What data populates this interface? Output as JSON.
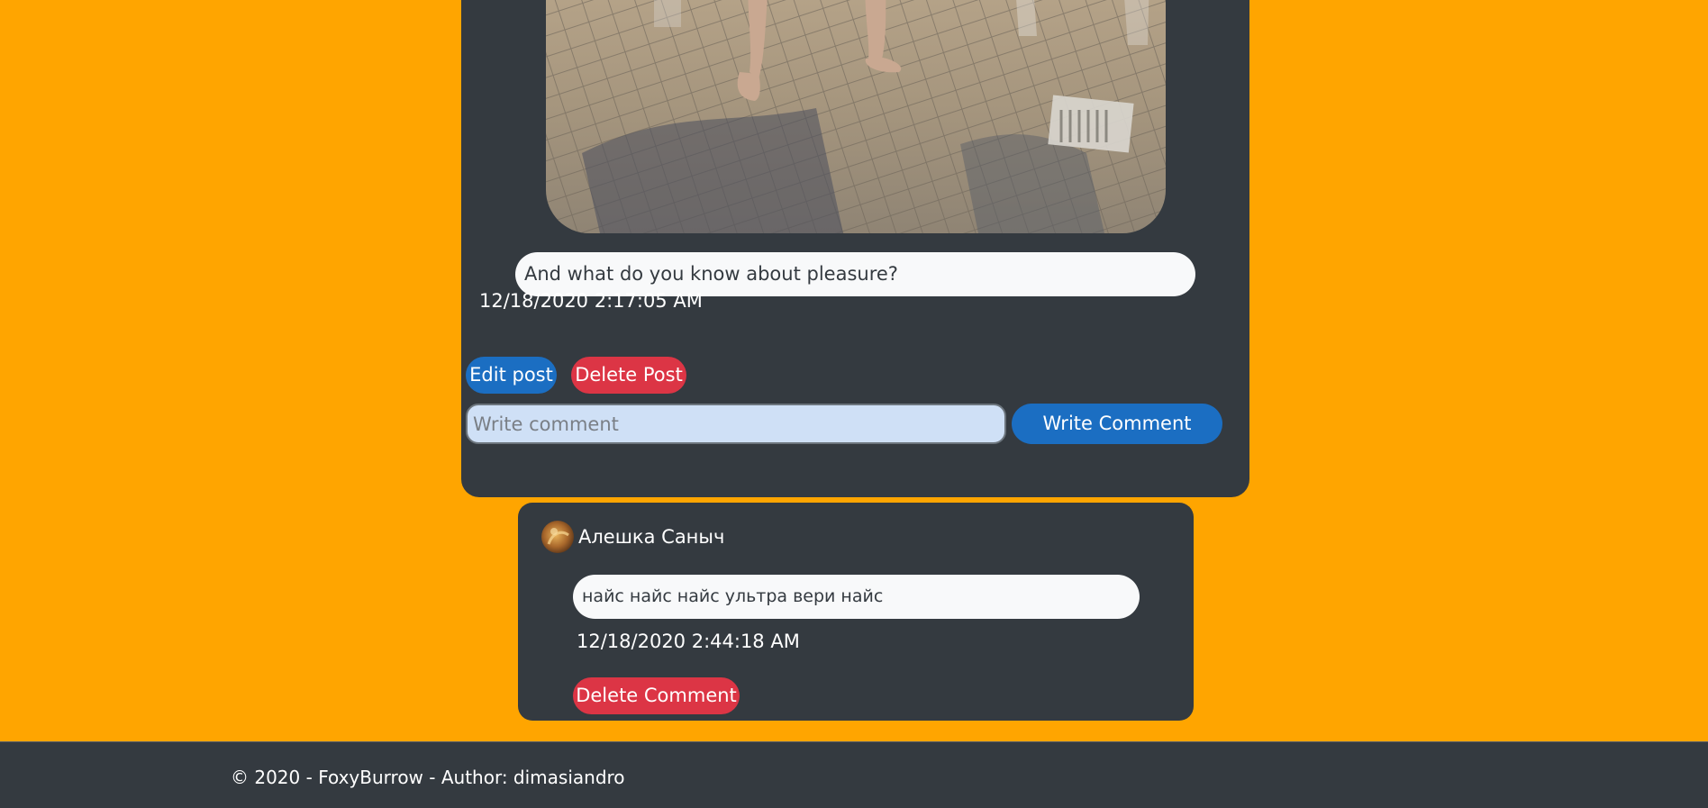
{
  "post": {
    "text": "And what do you know about pleasure?",
    "date": "12/18/2020 2:17:05 AM",
    "edit_label": "Edit post",
    "delete_label": "Delete Post",
    "comment_placeholder": "Write comment",
    "comment_value": "",
    "write_comment_label": "Write Comment"
  },
  "comment": {
    "author": "Алешка Саныч",
    "text": "найс найс найс ультра вери найс",
    "date": "12/18/2020 2:44:18 AM",
    "delete_label": "Delete Comment"
  },
  "footer": {
    "text": "© 2020 - FoxyBurrow - Author: dimasiandro"
  },
  "colors": {
    "page_background": "#ffa500",
    "card_background": "#343a40",
    "primary_button": "#1b6ec2",
    "danger_button": "#dc3545",
    "input_background": "#cfe0f6"
  }
}
